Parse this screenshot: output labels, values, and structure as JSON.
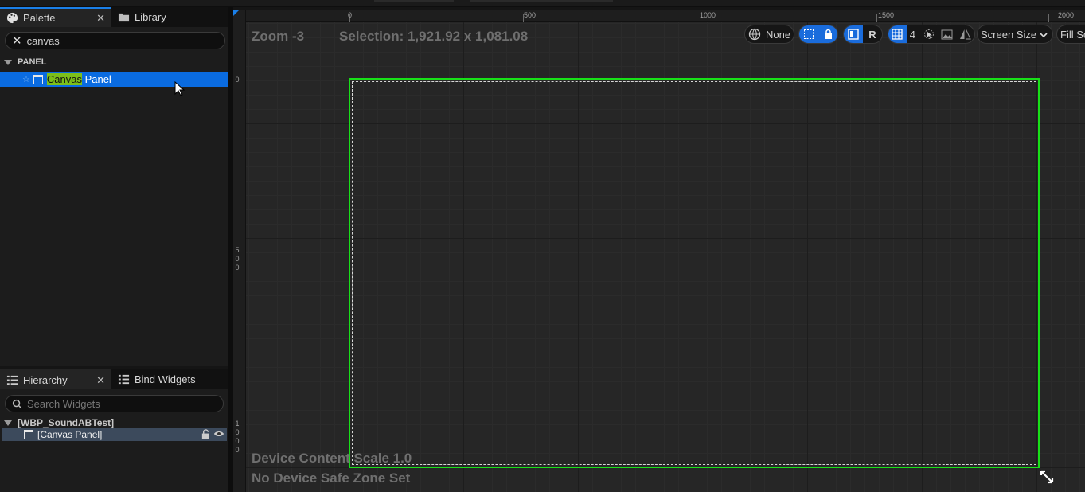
{
  "palette_panel": {
    "tabs": [
      {
        "label": "Palette",
        "icon": "palette-icon"
      },
      {
        "label": "Library",
        "icon": "folder-icon"
      }
    ],
    "search_value": "canvas",
    "category": "PANEL",
    "item": {
      "match": "Canvas",
      "rest": " Panel"
    }
  },
  "hierarchy_panel": {
    "tabs": [
      {
        "label": "Hierarchy",
        "icon": "hierarchy-icon"
      },
      {
        "label": "Bind Widgets",
        "icon": "list-icon"
      }
    ],
    "search_placeholder": "Search Widgets",
    "root": "[WBP_SoundABTest]",
    "child": "[Canvas Panel]"
  },
  "viewport": {
    "zoom": "Zoom -3",
    "selection": "Selection: 1,921.92 x 1,081.08",
    "ruler_top": [
      "0",
      "500",
      "1000",
      "1500",
      "2000"
    ],
    "ruler_left": [
      "0",
      "5\n0\n0",
      "1\n0\n0\n0"
    ],
    "toolbar": {
      "localization": "None",
      "respect_locks": "R",
      "grid_size": "4",
      "screen_size": "Screen Size",
      "fill_mode": "Fill Sc"
    },
    "device_scale": "Device Content Scale 1.0",
    "safe_zone": "No Device Safe Zone Set"
  },
  "colors": {
    "accent": "#1a6cdc",
    "selection_frame": "#18e018",
    "match_highlight": "#7cbf1a"
  }
}
